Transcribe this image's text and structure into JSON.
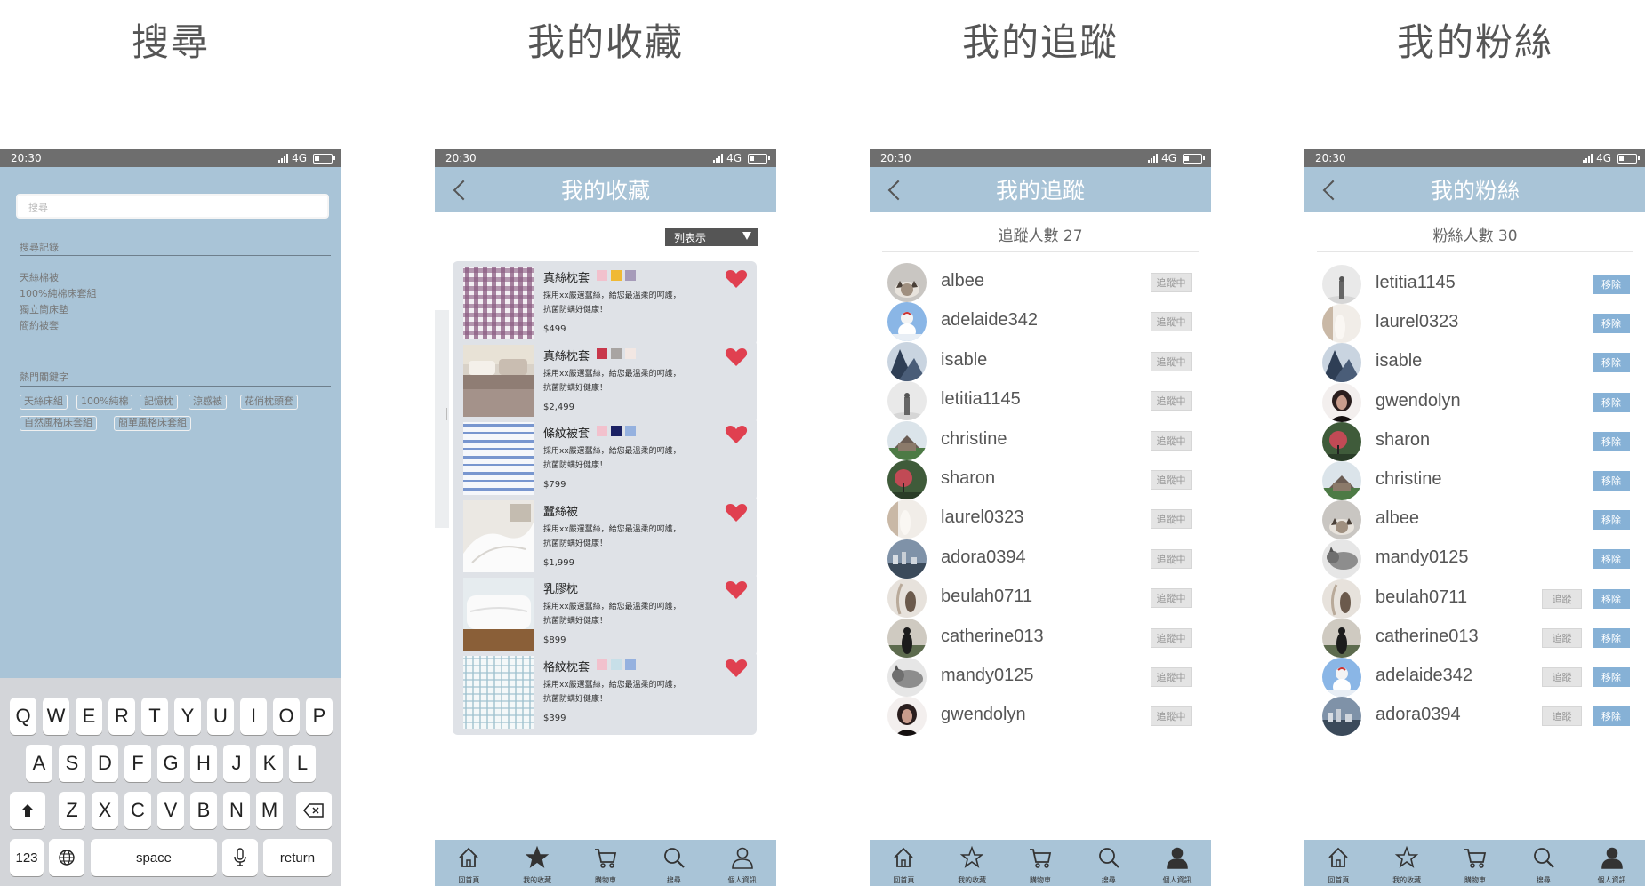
{
  "titles": {
    "search": "搜尋",
    "favorites": "我的收藏",
    "following": "我的追蹤",
    "followers": "我的粉絲"
  },
  "status": {
    "time": "20:30",
    "network": "4G"
  },
  "search": {
    "placeholder": "搜尋",
    "history_label": "搜尋記錄",
    "history": [
      "天絲棉被",
      "100%純棉床套組",
      "獨立筒床墊",
      "簡約被套"
    ],
    "hot_label": "熱門關鍵字",
    "tags": [
      "天絲床組",
      "100%純棉",
      "記憶枕",
      "涼感被",
      "花俏枕頭套",
      "自然風格床套組",
      "簡單風格床套組"
    ]
  },
  "keyboard": {
    "row1": [
      "Q",
      "W",
      "E",
      "R",
      "T",
      "Y",
      "U",
      "I",
      "O",
      "P"
    ],
    "row2": [
      "A",
      "S",
      "D",
      "F",
      "G",
      "H",
      "J",
      "K",
      "L"
    ],
    "row3": [
      "Z",
      "X",
      "C",
      "V",
      "B",
      "N",
      "M"
    ],
    "num": "123",
    "space": "space",
    "return": "return"
  },
  "favorites": {
    "header": "我的收藏",
    "view_mode": "列表示",
    "desc1": "採用xx嚴選蠶絲，給您最溫柔的呵護，",
    "desc2": "抗菌防螨好健康！",
    "items": [
      {
        "name": "真絲枕套",
        "price": "$499",
        "swatches": [
          "#f2c1cd",
          "#f0b934",
          "#a69bb9"
        ],
        "image": "plaid-purple"
      },
      {
        "name": "真絲枕套",
        "price": "$2,499",
        "swatches": [
          "#c8374b",
          "#a8a4a2",
          "#f2e7e3"
        ],
        "image": "bedroom"
      },
      {
        "name": "條紋被套",
        "price": "$799",
        "swatches": [
          "#f2c1cd",
          "#1b2164",
          "#95b1df"
        ],
        "image": "stripes-blue"
      },
      {
        "name": "蠶絲被",
        "price": "$1,999",
        "swatches": [],
        "image": "duvet-white"
      },
      {
        "name": "乳膠枕",
        "price": "$899",
        "swatches": [],
        "image": "pillow-white"
      },
      {
        "name": "格紋枕套",
        "price": "$399",
        "swatches": [
          "#f2c1cd",
          "#c7dfe8",
          "#95b1df"
        ],
        "image": "plaid-light"
      }
    ]
  },
  "following": {
    "header": "我的追蹤",
    "count_label": "追蹤人數 27",
    "btn_label": "追蹤中",
    "users": [
      "albee",
      "adelaide342",
      "isable",
      "letitia1145",
      "christine",
      "sharon",
      "laurel0323",
      "adora0394",
      "beulah0711",
      "catherine013",
      "mandy0125",
      "gwendolyn"
    ]
  },
  "followers": {
    "header": "我的粉絲",
    "count_label": "粉絲人數 30",
    "remove_label": "移除",
    "follow_label": "追蹤",
    "users": [
      {
        "name": "letitia1145",
        "follow_back": false
      },
      {
        "name": "laurel0323",
        "follow_back": false
      },
      {
        "name": "isable",
        "follow_back": false
      },
      {
        "name": "gwendolyn",
        "follow_back": false
      },
      {
        "name": "sharon",
        "follow_back": false
      },
      {
        "name": "christine",
        "follow_back": false
      },
      {
        "name": "albee",
        "follow_back": false
      },
      {
        "name": "mandy0125",
        "follow_back": false
      },
      {
        "name": "beulah0711",
        "follow_back": true
      },
      {
        "name": "catherine013",
        "follow_back": true
      },
      {
        "name": "adelaide342",
        "follow_back": true
      },
      {
        "name": "adora0394",
        "follow_back": true
      }
    ]
  },
  "nav": [
    "回首頁",
    "我的收藏",
    "購物車",
    "搜尋",
    "個人資訊"
  ],
  "colors": {
    "header_bg": "#a9c4d7",
    "heart": "#e04050",
    "remove_btn": "#86b1d6"
  }
}
